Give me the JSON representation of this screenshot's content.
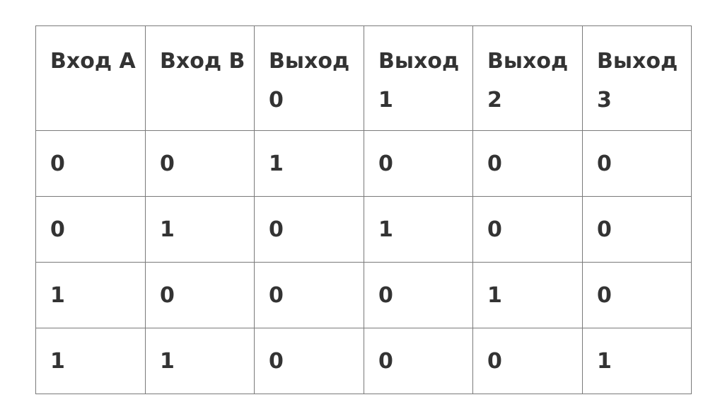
{
  "table": {
    "headers": [
      "Вход A",
      "Вход B",
      "Выход 0",
      "Выход 1",
      "Выход 2",
      "Выход 3"
    ],
    "rows": [
      [
        "0",
        "0",
        "1",
        "0",
        "0",
        "0"
      ],
      [
        "0",
        "1",
        "0",
        "1",
        "0",
        "0"
      ],
      [
        "1",
        "0",
        "0",
        "0",
        "1",
        "0"
      ],
      [
        "1",
        "1",
        "0",
        "0",
        "0",
        "1"
      ]
    ]
  }
}
